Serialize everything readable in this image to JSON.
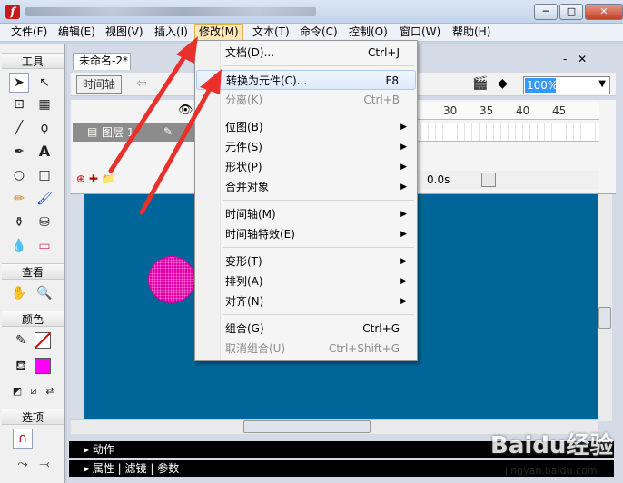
{
  "window": {
    "title_logo": "f",
    "controls": [
      "─",
      "□",
      "✕"
    ]
  },
  "menubar": [
    {
      "label": "文件(F)",
      "active": false
    },
    {
      "label": "编辑(E)",
      "active": false
    },
    {
      "label": "视图(V)",
      "active": false
    },
    {
      "label": "插入(I)",
      "active": false
    },
    {
      "label": "修改(M)",
      "active": true
    },
    {
      "label": "文本(T)",
      "active": false
    },
    {
      "label": "命令(C)",
      "active": false
    },
    {
      "label": "控制(O)",
      "active": false
    },
    {
      "label": "窗口(W)",
      "active": false
    },
    {
      "label": "帮助(H)",
      "active": false
    }
  ],
  "tools_panel": {
    "title": "工具",
    "view_title": "查看",
    "colors_title": "颜色",
    "options_title": "选项"
  },
  "document": {
    "tab": "未命名-2*",
    "tab_controls": "- ✕",
    "timeline_button": "时间轴",
    "zoom": "100%"
  },
  "timeline": {
    "layer_name": "图层 1",
    "ruler": [
      "30",
      "35",
      "40",
      "45"
    ],
    "time": "0.0s"
  },
  "modify_menu": {
    "items": [
      {
        "label": "文档(D)...",
        "shortcut": "Ctrl+J",
        "submenu": false,
        "disabled": false,
        "highlighted": false
      },
      {
        "label": "转换为元件(C)...",
        "shortcut": "F8",
        "submenu": false,
        "disabled": false,
        "highlighted": true
      },
      {
        "label": "分离(K)",
        "shortcut": "Ctrl+B",
        "submenu": false,
        "disabled": true,
        "highlighted": false
      },
      {
        "label": "位图(B)",
        "shortcut": "",
        "submenu": true,
        "disabled": false,
        "highlighted": false
      },
      {
        "label": "元件(S)",
        "shortcut": "",
        "submenu": true,
        "disabled": false,
        "highlighted": false
      },
      {
        "label": "形状(P)",
        "shortcut": "",
        "submenu": true,
        "disabled": false,
        "highlighted": false
      },
      {
        "label": "合并对象",
        "shortcut": "",
        "submenu": true,
        "disabled": false,
        "highlighted": false
      },
      {
        "label": "时间轴(M)",
        "shortcut": "",
        "submenu": true,
        "disabled": false,
        "highlighted": false
      },
      {
        "label": "时间轴特效(E)",
        "shortcut": "",
        "submenu": true,
        "disabled": false,
        "highlighted": false
      },
      {
        "label": "变形(T)",
        "shortcut": "",
        "submenu": true,
        "disabled": false,
        "highlighted": false
      },
      {
        "label": "排列(A)",
        "shortcut": "",
        "submenu": true,
        "disabled": false,
        "highlighted": false
      },
      {
        "label": "对齐(N)",
        "shortcut": "",
        "submenu": true,
        "disabled": false,
        "highlighted": false
      },
      {
        "label": "组合(G)",
        "shortcut": "Ctrl+G",
        "submenu": false,
        "disabled": false,
        "highlighted": false
      },
      {
        "label": "取消组合(U)",
        "shortcut": "Ctrl+Shift+G",
        "submenu": false,
        "disabled": true,
        "highlighted": false
      }
    ]
  },
  "panels": {
    "actions": "动作",
    "properties": "属性",
    "filters": "滤镜",
    "parameters": "参数"
  },
  "stage": {
    "background": "#00669a",
    "shape_color": "#e400a8"
  },
  "watermark": {
    "brand": "Baidu经验",
    "url": "jingyan.baidu.com"
  }
}
